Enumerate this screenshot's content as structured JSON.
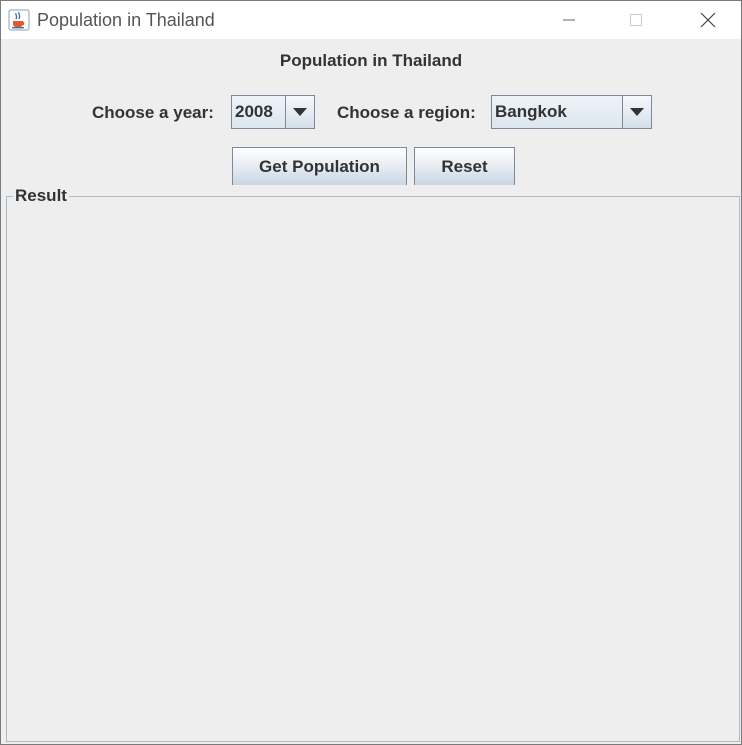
{
  "window": {
    "title": "Population in Thailand",
    "icon": "java-coffee-cup-icon"
  },
  "heading": "Population in Thailand",
  "form": {
    "year_label": "Choose a year:",
    "year_value": "2008",
    "region_label": "Choose a region:",
    "region_value": "Bangkok"
  },
  "buttons": {
    "get_population": "Get Population",
    "reset": "Reset"
  },
  "result": {
    "title": "Result",
    "content": ""
  },
  "colors": {
    "background": "#eeeeee",
    "panel_border": "#a7bccd",
    "text": "#333333"
  }
}
